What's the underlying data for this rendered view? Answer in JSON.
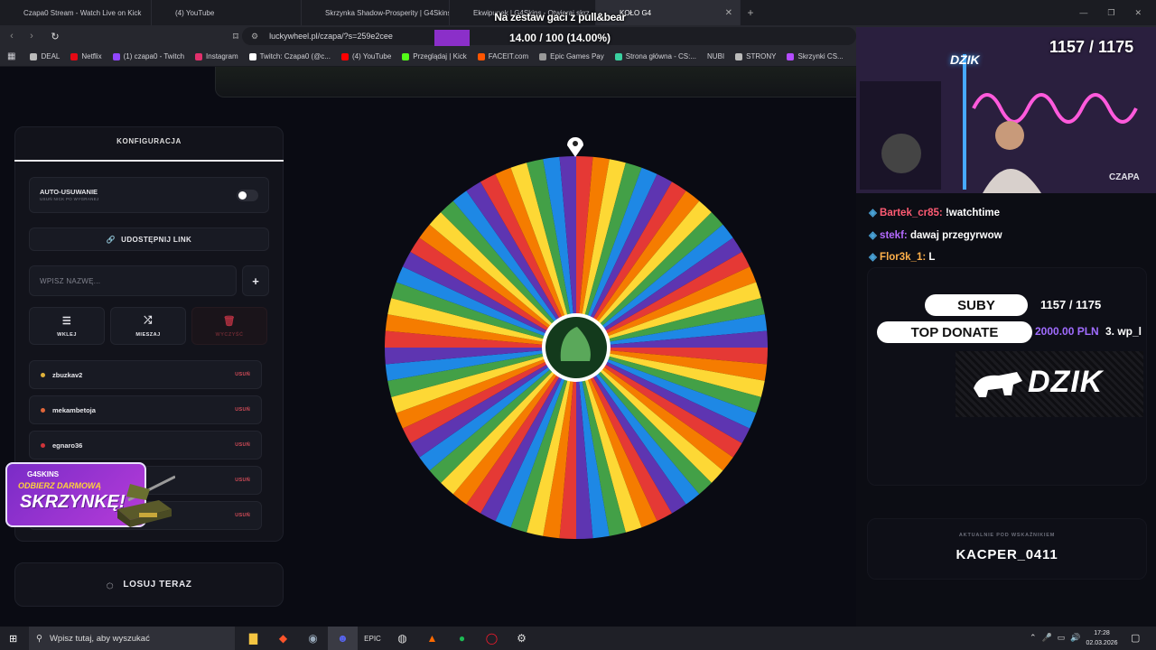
{
  "tabs": [
    {
      "label": "Czapa0 Stream - Watch Live on Kick",
      "color": "#53fc18"
    },
    {
      "label": "(4) YouTube",
      "color": "#ff0000"
    },
    {
      "label": "Skrzynka Shadow-Prosperity | G4Skins",
      "color": "#b44cff"
    },
    {
      "label": "Ekwipunek | G4Skins - Otwieraj skrz...",
      "color": "#b44cff"
    },
    {
      "label": "KOŁO G4",
      "color": "#6a6a6a"
    }
  ],
  "url": "luckywheel.pl/czapa/?s=259e2cee",
  "bookmarks": [
    "DEAL",
    "Netflix",
    "(1) czapa0 - Twitch",
    "Instagram",
    "Twitch: Czapa0 (@c...",
    "(4) YouTube",
    "Przeglądaj | Kick",
    "FACEIT.com",
    "Epic Games Pay",
    "Strona główna - CS:...",
    "NUBI",
    "STRONY",
    "Skrzynki CS..."
  ],
  "overlay": {
    "goal_text": "Na zestaw gaci z pull&bear",
    "progress_text": "14.00 / 100 (14.00%)",
    "progress": 0.14
  },
  "config": {
    "title": "KONFIGURACJA",
    "auto_remove_label": "AUTO-USUWANIE",
    "auto_remove_sub": "USUŃ NICK PO WYGRANEJ",
    "auto_remove_on": false,
    "share_label": "UDOSTĘPNIJ LINK",
    "name_placeholder": "WPISZ NAZWĘ...",
    "add_label": "+",
    "paste_label": "WKLEJ",
    "shuffle_label": "MIESZAJ",
    "clear_label": "WYCZYŚĆ",
    "remove_label": "USUŃ",
    "entries": [
      {
        "name": "zbuzkav2",
        "color": "#e0b23a"
      },
      {
        "name": "mekambetoja",
        "color": "#e0663a"
      },
      {
        "name": "egnaro36",
        "color": "#d0343a"
      },
      {
        "name": "",
        "color": "#6a3ad0"
      },
      {
        "name": "",
        "color": "#3a8ad0"
      }
    ],
    "draw_label": "LOSUJ TERAZ"
  },
  "promo": {
    "brand": "G4SKINS",
    "line1": "ODBIERZ DARMOWĄ",
    "line2": "SKRZYNKĘ!"
  },
  "wheel": {
    "segments": 72,
    "colors": [
      "#e53935",
      "#f57c00",
      "#fdd835",
      "#43a047",
      "#1e88e5",
      "#5e35b1"
    ]
  },
  "stream": {
    "subs_current": "1157",
    "subs_goal": "1175",
    "subs_display": "1157 / 1175",
    "cam_brand": "DZIK",
    "streamer_tag": "CZAPA",
    "chat": [
      {
        "user": "Bartek_cr85:",
        "msg": "!watchtime"
      },
      {
        "user": "stekf:",
        "msg": "dawaj przegyrwow"
      },
      {
        "user": "Flor3k_1:",
        "msg": "L"
      }
    ],
    "subs_label": "SUBY",
    "subs_small": "1157 / 1175",
    "top_donate_label": "TOP DONATE",
    "top_donate_value": "2000.00 PLN",
    "top_donate_name": "3. wp_l",
    "sponsor": "DZIK",
    "current_label": "AKTUALNIE POD WSKAŹNIKIEM",
    "current_value": "KACPER_0411"
  },
  "taskbar": {
    "search_placeholder": "Wpisz tutaj, aby wyszukać",
    "time": "17:28",
    "date": "02.03.2026"
  }
}
